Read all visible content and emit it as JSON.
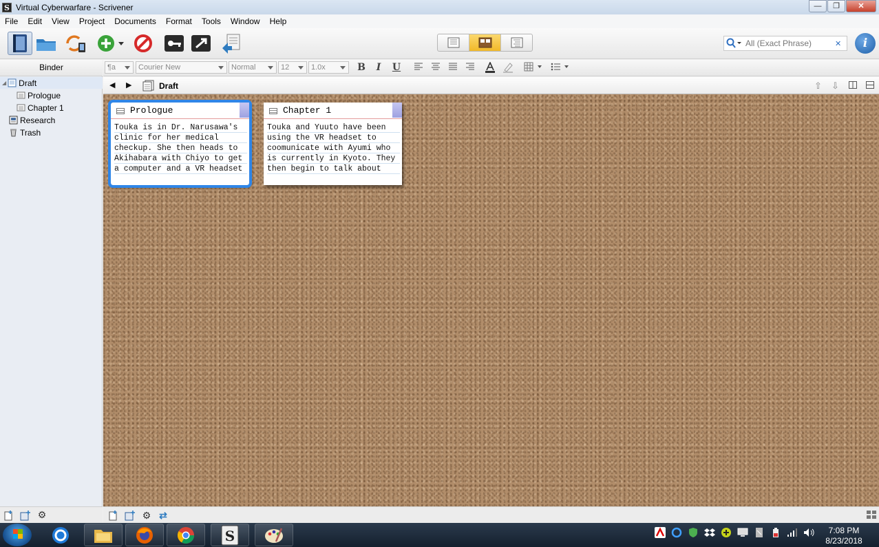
{
  "window": {
    "title": "Virtual Cyberwarfare - Scrivener",
    "minimize": "—",
    "maximize": "❐",
    "close": "✕"
  },
  "menu": [
    "File",
    "Edit",
    "View",
    "Project",
    "Documents",
    "Format",
    "Tools",
    "Window",
    "Help"
  ],
  "search": {
    "placeholder": "All (Exact Phrase)",
    "clear": "✕"
  },
  "binder": {
    "header": "Binder",
    "items": [
      {
        "label": "Draft",
        "icon": "draft-folder-icon"
      },
      {
        "label": "Prologue",
        "icon": "document-icon"
      },
      {
        "label": "Chapter 1",
        "icon": "document-icon"
      },
      {
        "label": "Research",
        "icon": "research-folder-icon"
      },
      {
        "label": "Trash",
        "icon": "trash-icon"
      }
    ]
  },
  "format": {
    "style": "¶a",
    "font": "Courier New",
    "weight": "Normal",
    "size": "12",
    "spacing": "1.0x",
    "bold": "B",
    "italic": "I",
    "underline": "U"
  },
  "editor": {
    "title": "Draft",
    "back": "◀",
    "forward": "▶"
  },
  "cards": [
    {
      "title": "Prologue",
      "synopsis": "Touka is in Dr. Narusawa's\nclinic for her medical\ncheckup. She then heads to\nAkihabara with Chiyo to get\na computer and a VR headset"
    },
    {
      "title": "Chapter 1",
      "synopsis": "Touka and Yuuto have been\nusing the VR headset to\ncoomunicate with Ayumi who\nis currently in Kyoto. They\nthen begin to talk about"
    }
  ],
  "clock": {
    "time": "7:08 PM",
    "date": "8/23/2018"
  },
  "colors": {
    "accent": "#2f86e8",
    "cork": "#b18d6a",
    "active_view": "#f2b929"
  }
}
